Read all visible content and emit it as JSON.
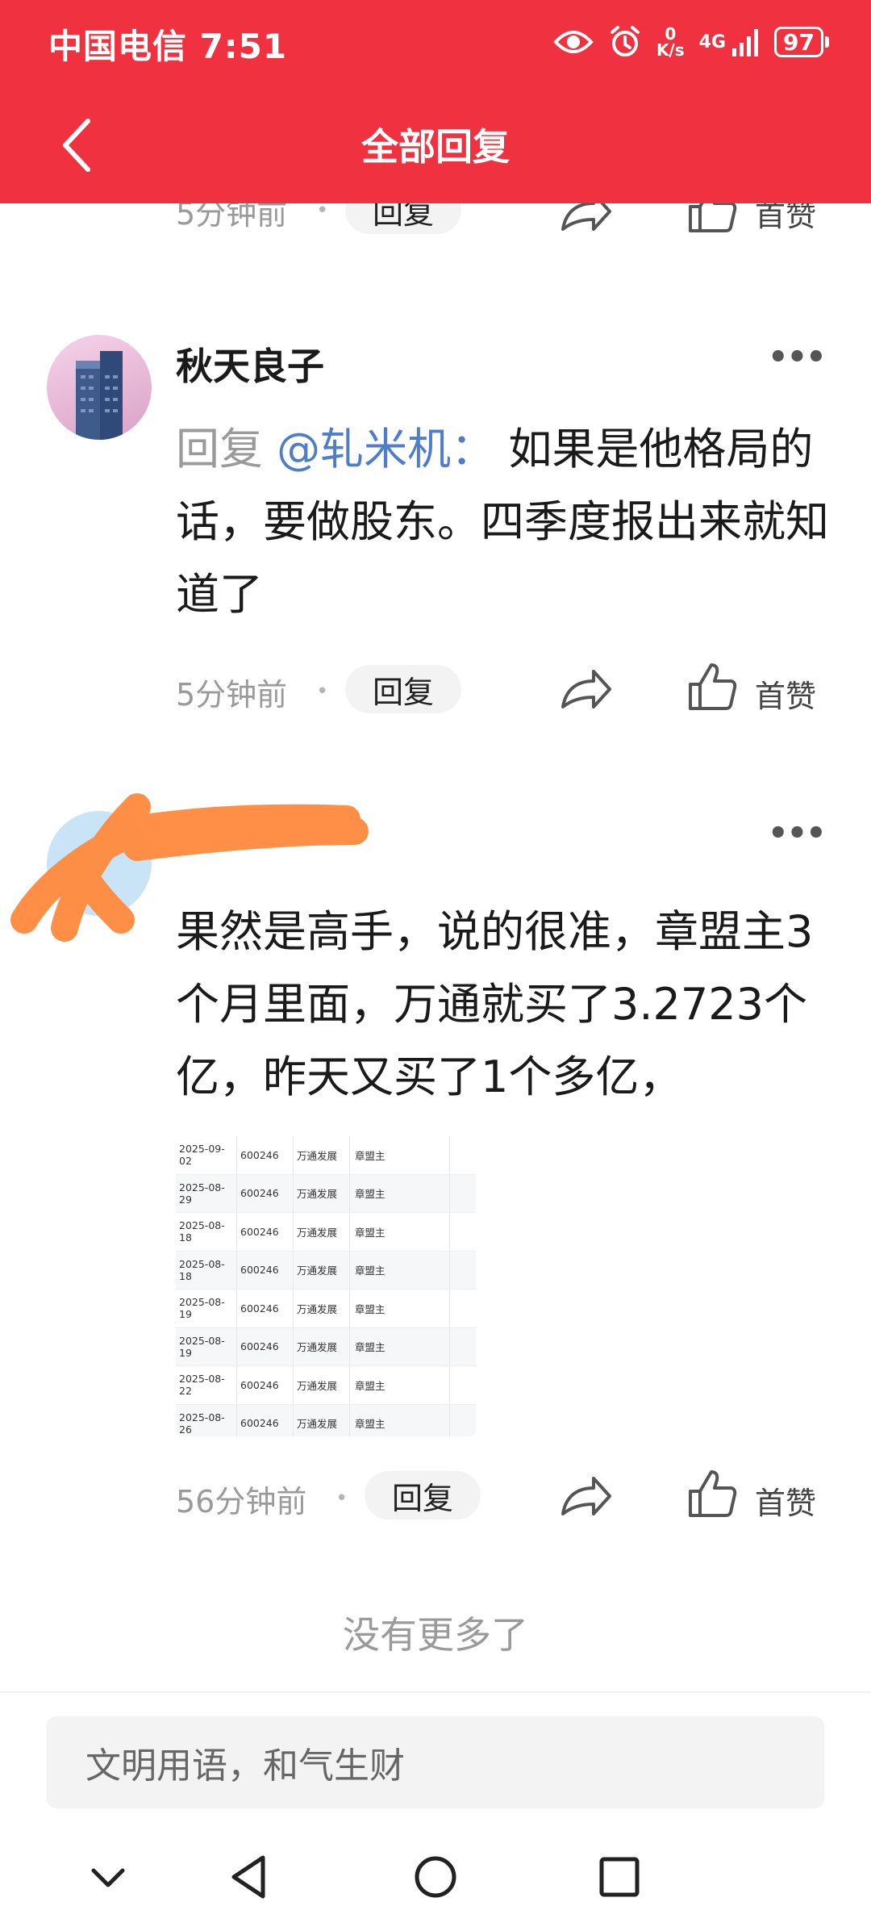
{
  "status_bar": {
    "carrier_time": "中国电信 7:51",
    "speed_value": "0",
    "speed_unit": "K/s",
    "network": "4G",
    "battery": "97"
  },
  "header": {
    "title": "全部回复"
  },
  "prev_comment": {
    "time": "5分钟前",
    "reply_label": "回复",
    "like_label": "首赞"
  },
  "comment1": {
    "username": "秋天良子",
    "reply_prefix": "回复",
    "mention": "@轧米机",
    "colon": "：",
    "text": "如果是他格局的话，要做股东。四季度报出来就知道了",
    "time": "5分钟前",
    "reply_label": "回复",
    "like_label": "首赞"
  },
  "comment2": {
    "text": "果然是高手，说的很准，章盟主3个月里面，万通就买了3.2723个亿，昨天又买了1个多亿，",
    "table_rows": [
      [
        "2025-09-02",
        "600246",
        "万通发展",
        "章盟主"
      ],
      [
        "2025-08-29",
        "600246",
        "万通发展",
        "章盟主"
      ],
      [
        "2025-08-18",
        "600246",
        "万通发展",
        "章盟主"
      ],
      [
        "2025-08-18",
        "600246",
        "万通发展",
        "章盟主"
      ],
      [
        "2025-08-19",
        "600246",
        "万通发展",
        "章盟主"
      ],
      [
        "2025-08-19",
        "600246",
        "万通发展",
        "章盟主"
      ],
      [
        "2025-08-22",
        "600246",
        "万通发展",
        "章盟主"
      ],
      [
        "2025-08-26",
        "600246",
        "万通发展",
        "章盟主"
      ]
    ],
    "time": "56分钟前",
    "reply_label": "回复",
    "like_label": "首赞"
  },
  "footer": {
    "no_more": "没有更多了",
    "input_placeholder": "文明用语，和气生财"
  },
  "colors": {
    "header_bg": "#f0313f",
    "mention": "#4f7dc9",
    "redaction": "#ff8a3d"
  }
}
